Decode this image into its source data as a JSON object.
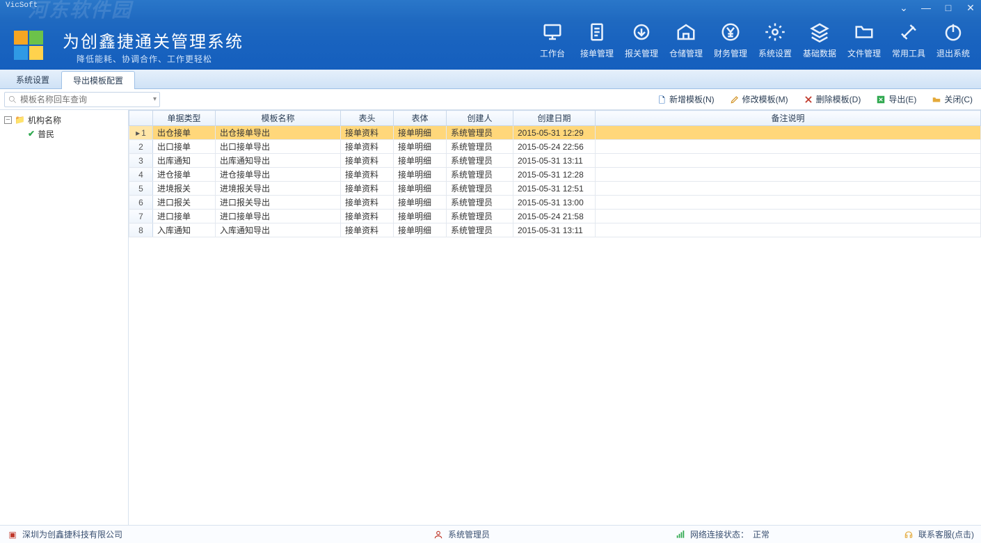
{
  "app": {
    "vicsoft": "VicSoft",
    "watermark": "河东软件园",
    "title": "为创鑫捷通关管理系统",
    "subtitle": "降低能耗、协调合作、工作更轻松"
  },
  "window_buttons": {
    "opts": "⌄",
    "min": "—",
    "max": "□",
    "close": "✕"
  },
  "ribbon": [
    {
      "id": "workbench",
      "label": "工作台"
    },
    {
      "id": "order",
      "label": "接单管理"
    },
    {
      "id": "customs",
      "label": "报关管理"
    },
    {
      "id": "warehouse",
      "label": "仓储管理"
    },
    {
      "id": "finance",
      "label": "财务管理"
    },
    {
      "id": "settings",
      "label": "系统设置"
    },
    {
      "id": "basedata",
      "label": "基础数据"
    },
    {
      "id": "files",
      "label": "文件管理"
    },
    {
      "id": "tools",
      "label": "常用工具"
    },
    {
      "id": "exit",
      "label": "退出系统"
    }
  ],
  "tabs": [
    {
      "id": "sys",
      "label": "系统设置",
      "active": false
    },
    {
      "id": "export",
      "label": "导出模板配置",
      "active": true
    }
  ],
  "search": {
    "placeholder": "模板名称回车查询"
  },
  "toolbar": {
    "add": "新增模板(N)",
    "edit": "修改模板(M)",
    "del": "删除模板(D)",
    "export": "导出(E)",
    "close": "关闭(C)"
  },
  "tree": {
    "root": "机构名称",
    "child": "普民"
  },
  "grid": {
    "headers": {
      "type": "单据类型",
      "name": "模板名称",
      "head": "表头",
      "body": "表体",
      "by": "创建人",
      "date": "创建日期",
      "note": "备注说明"
    },
    "rows": [
      {
        "n": "1",
        "type": "出仓接单",
        "name": "出仓接单导出",
        "hd": "接单资料",
        "bd": "接单明细",
        "by": "系统管理员",
        "dt": "2015-05-31 12:29",
        "note": ""
      },
      {
        "n": "2",
        "type": "出口接单",
        "name": "出口接单导出",
        "hd": "接单资料",
        "bd": "接单明细",
        "by": "系统管理员",
        "dt": "2015-05-24 22:56",
        "note": ""
      },
      {
        "n": "3",
        "type": "出库通知",
        "name": "出库通知导出",
        "hd": "接单资料",
        "bd": "接单明细",
        "by": "系统管理员",
        "dt": "2015-05-31 13:11",
        "note": ""
      },
      {
        "n": "4",
        "type": "进仓接单",
        "name": "进仓接单导出",
        "hd": "接单资料",
        "bd": "接单明细",
        "by": "系统管理员",
        "dt": "2015-05-31 12:28",
        "note": ""
      },
      {
        "n": "5",
        "type": "进境报关",
        "name": "进境报关导出",
        "hd": "接单资料",
        "bd": "接单明细",
        "by": "系统管理员",
        "dt": "2015-05-31 12:51",
        "note": ""
      },
      {
        "n": "6",
        "type": "进口报关",
        "name": "进口报关导出",
        "hd": "接单资料",
        "bd": "接单明细",
        "by": "系统管理员",
        "dt": "2015-05-31 13:00",
        "note": ""
      },
      {
        "n": "7",
        "type": "进口接单",
        "name": "进口接单导出",
        "hd": "接单资料",
        "bd": "接单明细",
        "by": "系统管理员",
        "dt": "2015-05-24 21:58",
        "note": ""
      },
      {
        "n": "8",
        "type": "入库通知",
        "name": "入库通知导出",
        "hd": "接单资料",
        "bd": "接单明细",
        "by": "系统管理员",
        "dt": "2015-05-31 13:11",
        "note": ""
      }
    ]
  },
  "status": {
    "company": "深圳为创鑫捷科技有限公司",
    "user": "系统管理员",
    "netlabel": "网络连接状态：",
    "net": "正常",
    "support": "联系客服(点击)"
  }
}
